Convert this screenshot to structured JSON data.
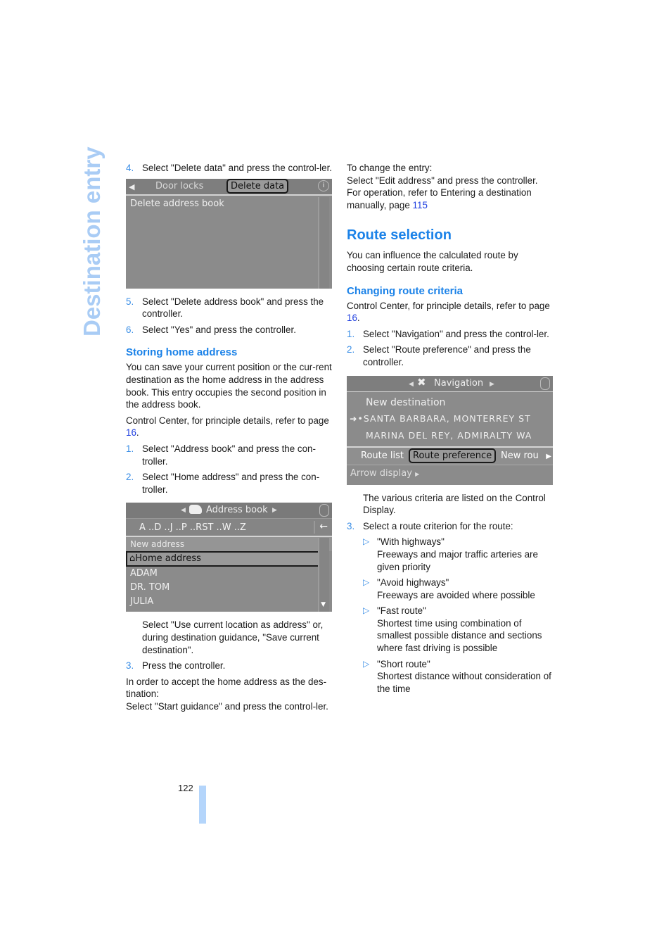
{
  "side_title": "Destination entry",
  "page_number": "122",
  "colors": {
    "accent": "#1b82e8",
    "side_title": "#a9ccf5",
    "link": "#1f3fe0",
    "page_tab": "#b4d5fb"
  },
  "left": {
    "step4": {
      "n": "4.",
      "text": "Select \"Delete data\" and press the control-ler."
    },
    "screen1": {
      "back_icon": "left-triangle-icon",
      "tabs": [
        "Door locks",
        "Delete data"
      ],
      "info_icon": "info-icon",
      "items": [
        "Delete address book"
      ]
    },
    "step5": {
      "n": "5.",
      "text": "Select \"Delete address book\" and press the controller."
    },
    "step6": {
      "n": "6.",
      "text": "Select \"Yes\" and press the controller."
    },
    "storing_heading": "Storing home address",
    "storing_para": "You can save your current position or the cur-rent destination as the home address in the address book. This entry occupies the second position in the address book.",
    "cc_para": {
      "text": "Control Center, for principle details, refer to page ",
      "link": "16",
      "end": "."
    },
    "step1": {
      "n": "1.",
      "text": "Select \"Address book\" and press the con-troller."
    },
    "step2": {
      "n": "2.",
      "text": "Select \"Home address\" and press the con-troller."
    },
    "screen2": {
      "title": "Address book",
      "alpha": "A ..D ..J ..P ..RST ..W ..Z",
      "items": [
        "New address",
        "Home address",
        "ADAM",
        "DR. TOM",
        "JULIA"
      ]
    },
    "step2_cont": "Select \"Use current location as address\" or, during destination guidance, \"Save current destination\".",
    "step3": {
      "n": "3.",
      "text": "Press the controller."
    },
    "accept_para_1": "In order to accept the home address as the des-tination:",
    "accept_para_2": "Select \"Start guidance\" and press the control-ler."
  },
  "right": {
    "change_1": "To change the entry:",
    "change_2": "Select \"Edit address\" and press the controller.",
    "change_3": {
      "text": "For operation, refer to Entering a destination manually, page ",
      "link": "115"
    },
    "route_heading": "Route selection",
    "route_para": "You can influence the calculated route by choosing certain route criteria.",
    "changing_heading": "Changing route criteria",
    "cc_para": {
      "text": "Control Center, for principle details, refer to page ",
      "link": "16",
      "end": "."
    },
    "step1": {
      "n": "1.",
      "text": "Select \"Navigation\" and press the control-ler."
    },
    "step2": {
      "n": "2.",
      "text": "Select \"Route preference\" and press the controller."
    },
    "screen3": {
      "title": "Navigation",
      "items": [
        "New destination",
        "SANTA BARBARA, MONTERREY ST",
        "MARINA DEL REY, ADMIRALTY WA"
      ],
      "tabs": [
        "Route list",
        "Route preference",
        "New rou"
      ],
      "bottom": "Arrow display"
    },
    "step2_cont": "The various criteria are listed on the Control Display.",
    "step3": {
      "n": "3.",
      "text": "Select a route criterion for the route:"
    },
    "criteria": [
      {
        "name": "\"With highways\"",
        "desc": "Freeways and major traffic arteries are given priority"
      },
      {
        "name": "\"Avoid highways\"",
        "desc": "Freeways are avoided where possible"
      },
      {
        "name": "\"Fast route\"",
        "desc": "Shortest time using combination of smallest possible distance and sections where fast driving is possible"
      },
      {
        "name": "\"Short route\"",
        "desc": "Shortest distance without consideration of the time"
      }
    ]
  }
}
